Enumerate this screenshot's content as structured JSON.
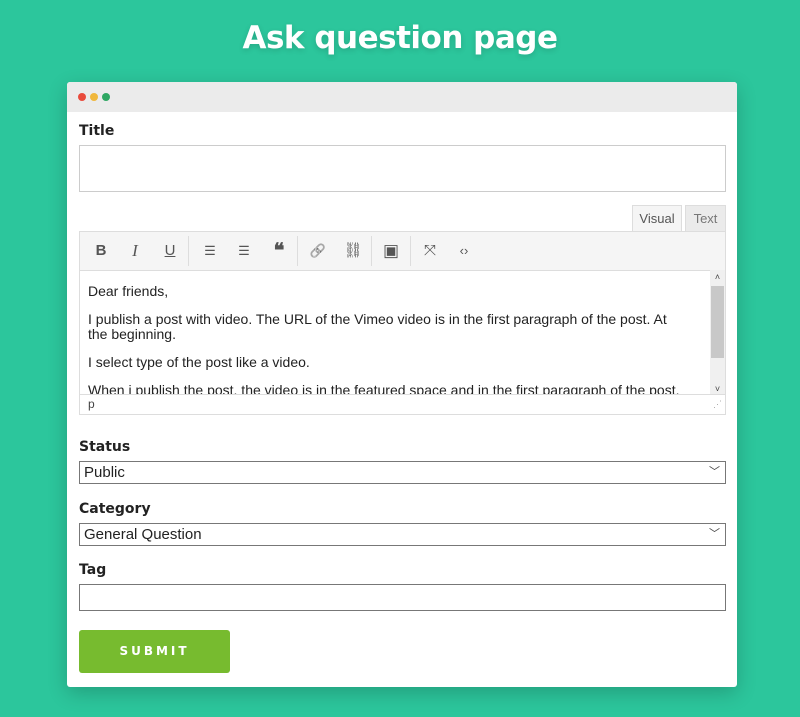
{
  "page_title": "Ask question page",
  "window": {
    "dots": [
      "#e94b3c",
      "#f0b73c",
      "#2fa763"
    ]
  },
  "form": {
    "title_label": "Title",
    "title_value": "",
    "tabs": [
      {
        "label": "Visual",
        "active": true
      },
      {
        "label": "Text",
        "active": false
      }
    ],
    "toolbar": [
      {
        "icon": "bold-icon",
        "glyph": "B"
      },
      {
        "icon": "italic-icon",
        "glyph": "I"
      },
      {
        "icon": "underline-icon",
        "glyph": "U"
      },
      {
        "icon": "bullet-list-icon",
        "glyph": "☰"
      },
      {
        "icon": "numbered-list-icon",
        "glyph": "☰"
      },
      {
        "icon": "blockquote-icon",
        "glyph": "❝"
      },
      {
        "icon": "link-icon",
        "glyph": "🔗"
      },
      {
        "icon": "unlink-icon",
        "glyph": "⛓"
      },
      {
        "icon": "image-icon",
        "glyph": "▣"
      },
      {
        "icon": "fullscreen-icon",
        "glyph": "⤧"
      },
      {
        "icon": "code-icon",
        "glyph": "‹›"
      }
    ],
    "content": [
      "Dear friends,",
      "I publish a post with video. The URL of the Vimeo video is in the first paragraph of the post. At the beginning.",
      "I select type of the post like a video.",
      "When i publish the post, the video is in the featured space and in the first paragraph of the post. I only"
    ],
    "path": "p",
    "status_label": "Status",
    "status_value": "Public",
    "category_label": "Category",
    "category_value": "General Question",
    "tag_label": "Tag",
    "tag_value": "",
    "submit_label": "SUBMIT"
  },
  "colors": {
    "background": "#2cc69c",
    "submit": "#77bb2f"
  }
}
